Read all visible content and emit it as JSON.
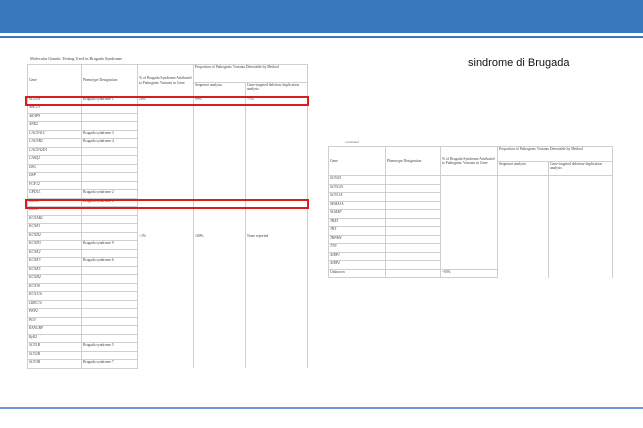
{
  "slide": {
    "side_title": "sindrome di Brugada",
    "table1_caption": "Molecular Genetic Testing Used in Brugada Syndrome",
    "table2_caption": "continued"
  },
  "colors": {
    "banner": "#3a78be",
    "highlight": "#d62020"
  },
  "table1": {
    "headers": {
      "gene": "Gene",
      "phenotype": "Phenotype Designation",
      "percent": "% of Brugada Syndrome Attributed to Pathogenic Variants in Gene",
      "group": "Proportion of Pathogenic Variants Detectable by Method",
      "seq": "Sequence analysis",
      "del": "Gene-targeted deletion/ duplication analysis"
    },
    "first_row": {
      "gene": "SCN5A",
      "phenotype": "Brugada syndrome 1",
      "percent": "20%",
      "seq": "99%",
      "del": "~1%"
    },
    "other_rows": [
      {
        "gene": "ABCC9",
        "phenotype": ""
      },
      {
        "gene": "AKAP9",
        "phenotype": ""
      },
      {
        "gene": "ANK2",
        "phenotype": ""
      },
      {
        "gene": "CACNA1C",
        "phenotype": "Brugada syndrome 3"
      },
      {
        "gene": "CACNB2",
        "phenotype": "Brugada syndrome 4"
      },
      {
        "gene": "CACNA2D1",
        "phenotype": ""
      },
      {
        "gene": "CASQ2",
        "phenotype": ""
      },
      {
        "gene": "DSG",
        "phenotype": ""
      },
      {
        "gene": "DSP",
        "phenotype": ""
      },
      {
        "gene": "FGF12",
        "phenotype": ""
      },
      {
        "gene": "GPD1L",
        "phenotype": "Brugada syndrome 2"
      },
      {
        "gene": "HCN4",
        "phenotype": "Brugada syndrome 8"
      },
      {
        "gene": "HEY2",
        "phenotype": ""
      },
      {
        "gene": "KCNAB2",
        "phenotype": ""
      },
      {
        "gene": "KCNE1",
        "phenotype": ""
      },
      {
        "gene": "KCND2",
        "phenotype": ""
      },
      {
        "gene": "KCND3",
        "phenotype": "Brugada syndrome 9"
      },
      {
        "gene": "KCNE2",
        "phenotype": ""
      },
      {
        "gene": "KCNE3",
        "phenotype": "Brugada syndrome 6"
      },
      {
        "gene": "KCNE5",
        "phenotype": ""
      },
      {
        "gene": "KCNH2",
        "phenotype": ""
      },
      {
        "gene": "KCNJ8",
        "phenotype": ""
      },
      {
        "gene": "KCNJ16",
        "phenotype": ""
      },
      {
        "gene": "LRRC10",
        "phenotype": ""
      },
      {
        "gene": "PKP2",
        "phenotype": ""
      },
      {
        "gene": "PLN",
        "phenotype": ""
      },
      {
        "gene": "RANGRF",
        "phenotype": ""
      },
      {
        "gene": "RyR2",
        "phenotype": ""
      },
      {
        "gene": "SCN1B",
        "phenotype": "Brugada syndrome 5"
      },
      {
        "gene": "SCN2B",
        "phenotype": ""
      },
      {
        "gene": "SCN3B",
        "phenotype": "Brugada syndrome 7"
      }
    ],
    "merged": {
      "percent": "<1%",
      "seq": "100%",
      "del": "None reported"
    }
  },
  "table2": {
    "headers": {
      "gene": "Gene",
      "phenotype": "Phenotype Designation",
      "percent": "% of Brugada Syndrome Attributed to Pathogenic Variants in Gene",
      "group": "Proportion of Pathogenic Variants Detectable by Method",
      "seq": "Sequence analysis",
      "del": "Gene-targeted deletion/ duplication analysis"
    },
    "rows": [
      {
        "gene": "SCN4A"
      },
      {
        "gene": "SCN10A"
      },
      {
        "gene": "SCN11A"
      },
      {
        "gene": "SEMA3A"
      },
      {
        "gene": "SLMAP"
      },
      {
        "gene": "TBX5"
      },
      {
        "gene": "TRT"
      },
      {
        "gene": "TRPM4"
      },
      {
        "gene": "TTN"
      },
      {
        "gene": "XIRP1"
      },
      {
        "gene": "XIRP2"
      }
    ],
    "unknown": {
      "gene": "Unknown",
      "percent": "~65%"
    }
  }
}
